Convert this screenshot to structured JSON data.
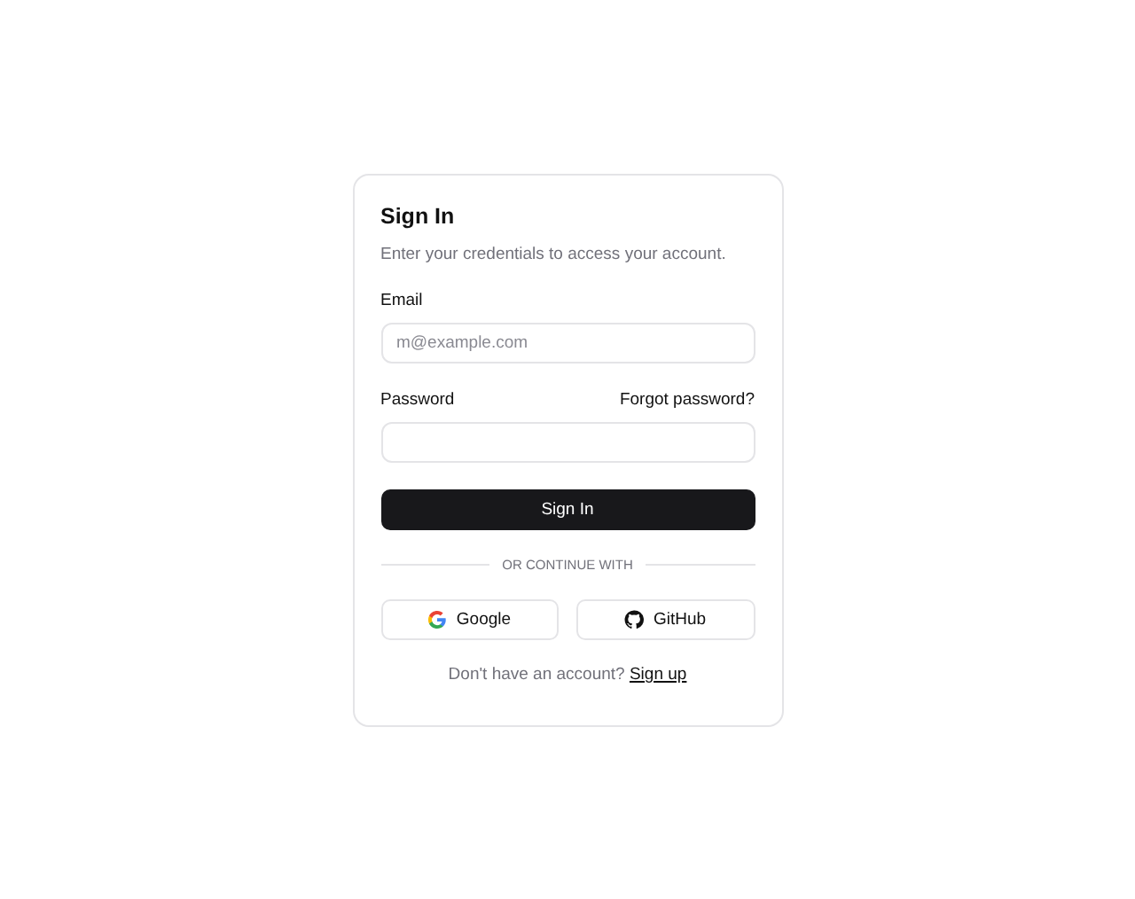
{
  "card": {
    "title": "Sign In",
    "description": "Enter your credentials to access your account."
  },
  "email": {
    "label": "Email",
    "placeholder": "m@example.com"
  },
  "password": {
    "label": "Password",
    "forgot_link": "Forgot password?"
  },
  "submit_button": "Sign In",
  "divider": "OR CONTINUE WITH",
  "providers": [
    {
      "kind": "google",
      "label": "Google"
    },
    {
      "kind": "github",
      "label": "GitHub"
    }
  ],
  "footer": {
    "text": "Don't have an account?",
    "link": "Sign up"
  }
}
